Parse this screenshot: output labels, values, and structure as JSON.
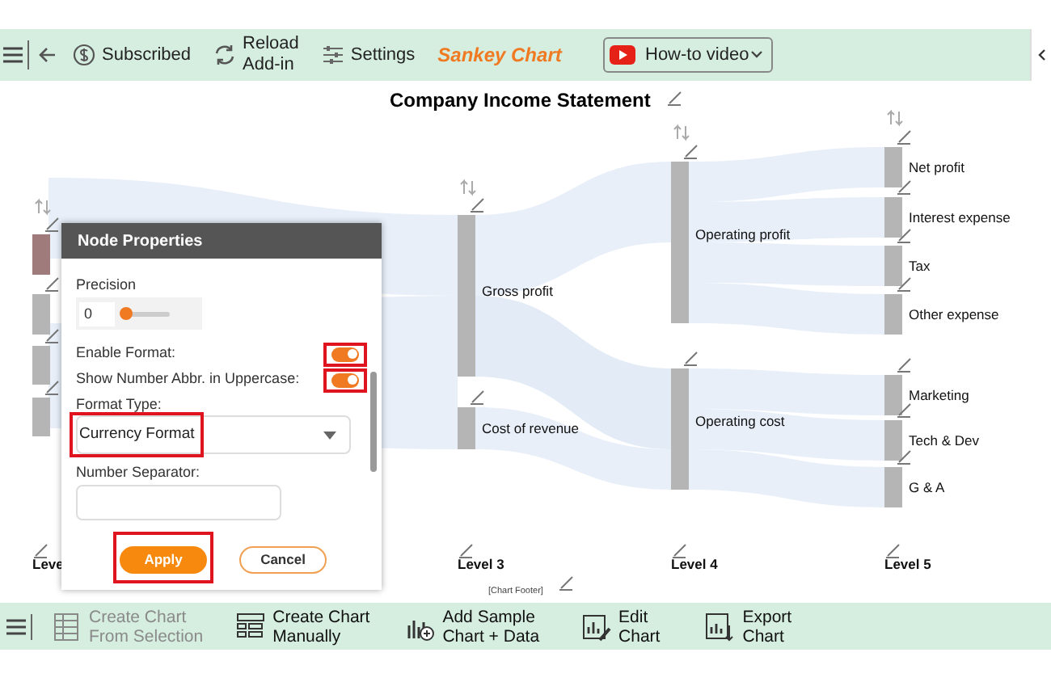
{
  "top_toolbar": {
    "items": [
      {
        "kind": "icon-text",
        "label": "Subscribed"
      },
      {
        "kind": "icon-text",
        "label": "Reload\nAdd-in"
      },
      {
        "kind": "icon-text",
        "label": "Settings"
      },
      {
        "kind": "brand",
        "label": "Sankey Chart"
      }
    ],
    "video_button": {
      "label": "How-to video"
    }
  },
  "chart": {
    "title": "Company Income Statement",
    "footer": "[Chart Footer]",
    "levels": [
      {
        "label": "Leve",
        "nodes": [
          {
            "highlighted": true
          },
          {
            "highlighted": false
          },
          {
            "highlighted": false
          },
          {
            "highlighted": false
          }
        ]
      },
      {
        "label": "Level 3",
        "nodes": [
          {
            "label": "Gross profit",
            "highlighted": false
          },
          {
            "label": "Cost of revenue",
            "highlighted": false
          }
        ]
      },
      {
        "label": "Level 4",
        "nodes": [
          {
            "label": "Operating profit",
            "highlighted": false
          },
          {
            "label": "Operating cost",
            "highlighted": false
          }
        ]
      },
      {
        "label": "Level 5",
        "nodes": [
          {
            "label": "Net profit",
            "highlighted": false
          },
          {
            "label": "Interest expense",
            "highlighted": false
          },
          {
            "label": "Tax",
            "highlighted": false
          },
          {
            "label": "Other expense",
            "highlighted": false
          },
          {
            "label": "Marketing",
            "highlighted": false
          },
          {
            "label": "Tech & Dev",
            "highlighted": false
          },
          {
            "label": "G & A",
            "highlighted": false
          }
        ]
      }
    ]
  },
  "dialog": {
    "title": "Node Properties",
    "precision": {
      "label": "Precision",
      "value": "0",
      "level": 0.1
    },
    "toggles": [
      {
        "label": "Enable Format:",
        "on": true,
        "highlighted": true
      },
      {
        "label": "Show Number Abbr. in Uppercase:",
        "on": true,
        "highlighted": true
      }
    ],
    "format_type": {
      "label": "Format Type:",
      "value": "Currency Format",
      "highlighted": true
    },
    "number_separator": {
      "label": "Number Separator:"
    },
    "buttons": [
      {
        "kind": "primary",
        "label": "Apply",
        "highlighted": true
      },
      {
        "kind": "secondary",
        "label": "Cancel",
        "highlighted": false
      }
    ]
  },
  "bottom_toolbar": {
    "items": [
      {
        "label": "Create Chart\nFrom Selection",
        "disabled": true
      },
      {
        "label": "Create Chart\nManually",
        "disabled": false
      },
      {
        "label": "Add Sample\nChart + Data",
        "disabled": false
      },
      {
        "label": "Edit\nChart",
        "disabled": false
      },
      {
        "label": "Export\nChart",
        "disabled": false
      }
    ]
  }
}
